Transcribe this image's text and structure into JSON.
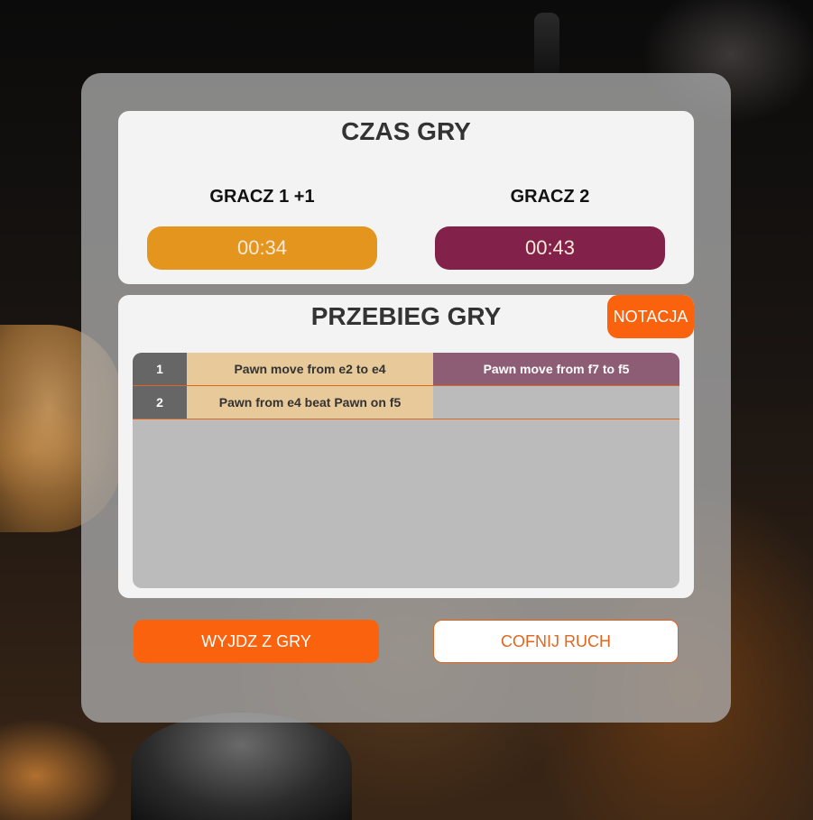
{
  "colors": {
    "accent": "#fa620d",
    "player1_timer": "#e3951e",
    "player2_timer": "#82224a",
    "move_number_bg": "#666666",
    "move_white_bg": "#e8c99a",
    "move_black_bg": "#8d5c75",
    "move_empty_bg": "#bcbbbc",
    "undo_text": "#e2651e"
  },
  "time_card": {
    "title": "CZAS GRY",
    "player1": {
      "name": "GRACZ 1 +1",
      "time": "00:34"
    },
    "player2": {
      "name": "GRACZ 2",
      "time": "00:43"
    }
  },
  "moves_card": {
    "title": "PRZEBIEG GRY",
    "notation_button": "NOTACJA",
    "moves": [
      {
        "number": "1",
        "white": "Pawn move from e2 to e4",
        "black": "Pawn move from f7 to f5"
      },
      {
        "number": "2",
        "white": "Pawn from e4 beat Pawn on f5",
        "black": ""
      }
    ]
  },
  "actions": {
    "exit_label": "WYJDZ Z GRY",
    "undo_label": "COFNIJ RUCH"
  }
}
